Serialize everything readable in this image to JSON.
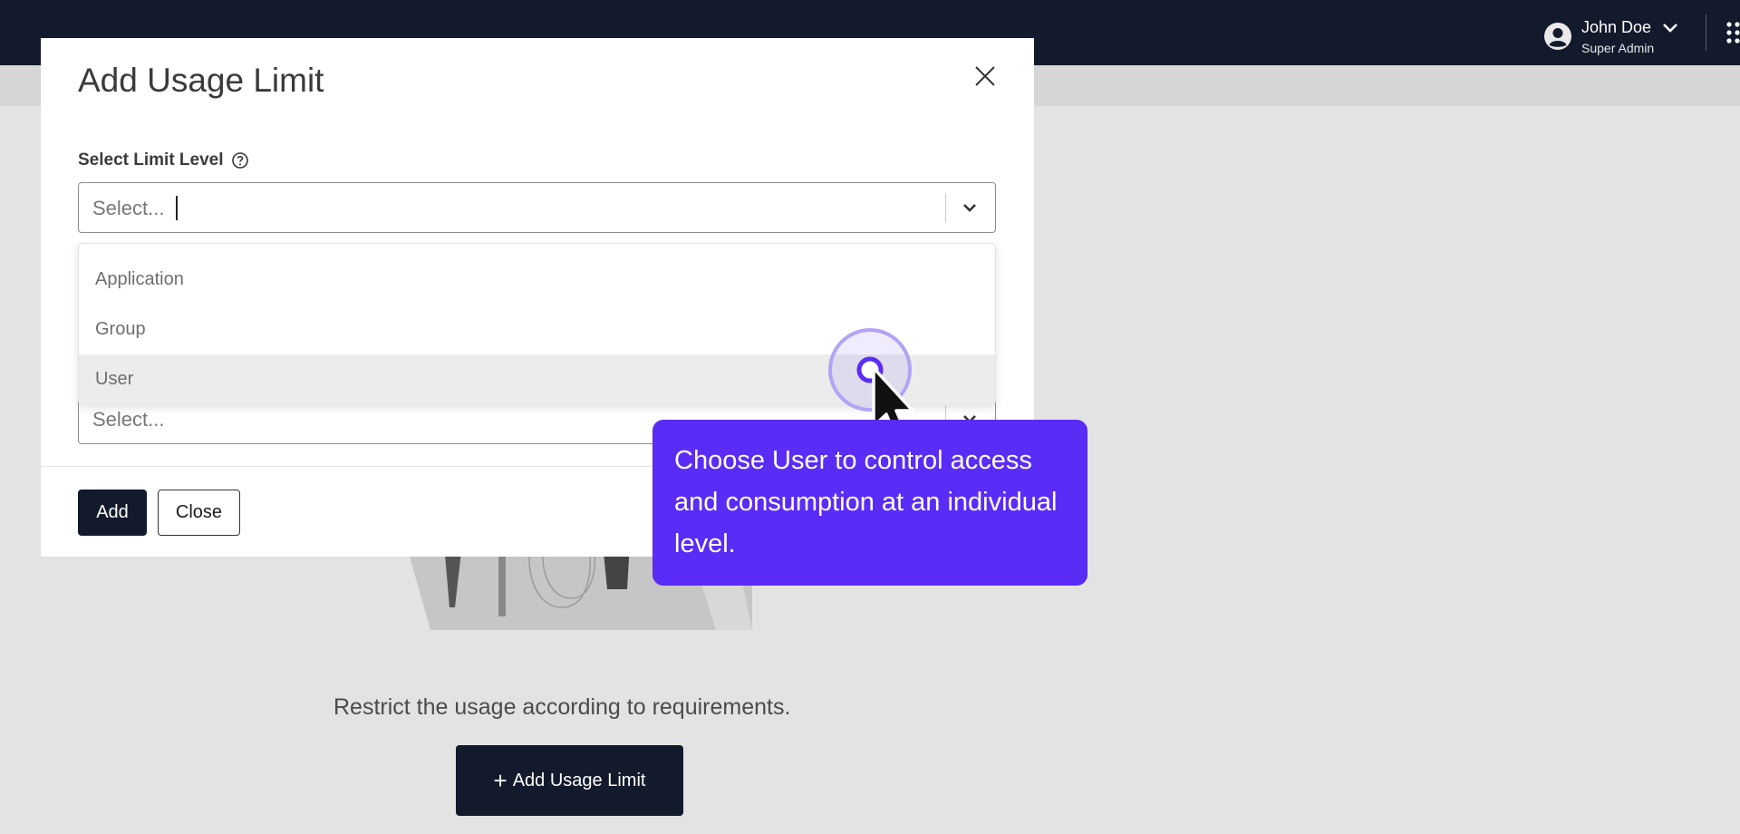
{
  "header": {
    "user_name": "John Doe",
    "user_role": "Super Admin",
    "icons": [
      "user-avatar-icon",
      "chevron-down-icon",
      "apps-grid-icon"
    ]
  },
  "page": {
    "empty_message": "Restrict the usage according to requirements.",
    "add_button_plus": "+",
    "add_button_label": "Add Usage Limit"
  },
  "modal": {
    "title": "Add Usage Limit",
    "limit_level_label": "Select Limit Level",
    "limit_level_placeholder": "Select...",
    "second_select_placeholder": "Select...",
    "options": [
      "Application",
      "Group",
      "User"
    ],
    "hovered_option": "User",
    "add_label": "Add",
    "close_label": "Close"
  },
  "tooltip": {
    "text": "Choose User to control access and consumption at an individual level."
  },
  "colors": {
    "topbar": "#121a2c",
    "primary_button": "#121a2c",
    "tooltip": "#5a2cf6"
  }
}
